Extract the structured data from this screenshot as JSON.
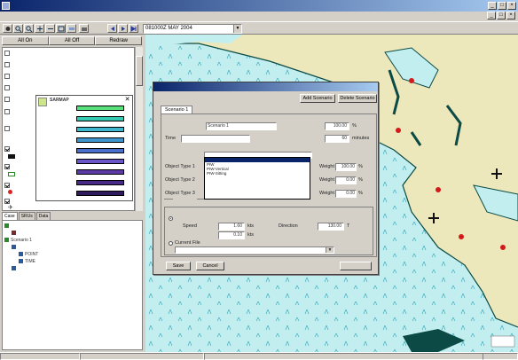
{
  "window": {
    "title": "",
    "controls": [
      "_",
      "□",
      "×"
    ]
  },
  "menu": [
    "",
    "",
    "",
    "",
    "",
    ""
  ],
  "toolbar": {
    "date_value": "081000Z MAY 2004"
  },
  "left_buttons": [
    "All On",
    "All Off",
    "Redraw"
  ],
  "layers": [
    {
      "label": "",
      "checked": false
    },
    {
      "label": "",
      "checked": false
    },
    {
      "label": "",
      "checked": false
    },
    {
      "label": "",
      "checked": false
    },
    {
      "label": "",
      "checked": false
    },
    {
      "label": "",
      "checked": false
    },
    {
      "label": "",
      "checked": false
    },
    {
      "label": "",
      "checked": true
    },
    {
      "label": "",
      "checked": true
    },
    {
      "label": "",
      "checked": true
    },
    {
      "label": "",
      "checked": true
    },
    {
      "label": "",
      "checked": true
    },
    {
      "label": "",
      "checked": true
    }
  ],
  "legend": {
    "title": "SARMAP",
    "rows": [
      {
        "label": "",
        "color": "#59e07a"
      },
      {
        "label": "",
        "color": "#34c9b0"
      },
      {
        "label": "",
        "color": "#3fb7cc"
      },
      {
        "label": "",
        "color": "#3f96cf"
      },
      {
        "label": "",
        "color": "#4a6ecc"
      },
      {
        "label": "",
        "color": "#6a56c8"
      },
      {
        "label": "",
        "color": "#5b3aa6"
      },
      {
        "label": "",
        "color": "#472a85"
      },
      {
        "label": "",
        "color": "#301a5e"
      }
    ]
  },
  "bottom_tabs": [
    "Case",
    "SRUs",
    "Data"
  ],
  "tree": [
    {
      "label": "",
      "color": "#2a8a2a"
    },
    {
      "label": "",
      "color": "#7a2a2a"
    },
    {
      "label": "Scenario 1",
      "color": "#2a8a2a"
    },
    {
      "label": "",
      "color": "#2a5a9a"
    },
    {
      "label": "POINT",
      "color": "#2a5a9a"
    },
    {
      "label": "TIME",
      "color": "#2a5a9a"
    },
    {
      "label": "",
      "color": "#2a5a9a"
    }
  ],
  "status": [
    "",
    "",
    ""
  ],
  "map_scale": "",
  "dialog": {
    "title": "",
    "add_scenario": "Add Scenario",
    "delete_scenario": "Delete Scenario",
    "tab": "Scenario 1",
    "settings_label": "",
    "name_label": "",
    "name_value": "Scenario 1",
    "weight_label": "",
    "weight_value": "100.00",
    "pct": "%",
    "time_label": "Time",
    "time_value": "",
    "plusminus_label": "",
    "plusminus_value": "60",
    "minutes": "minutes",
    "objects_label": "",
    "original_craft_label": "",
    "object_type_labels": [
      "Object Type 1",
      "Object Type 2",
      "Object Type 3"
    ],
    "object_weight_labels": [
      "Weight",
      "Weight",
      "Weight"
    ],
    "object_weights": [
      "100.00",
      "0.00",
      "0.00"
    ],
    "craft_dropdown": [
      "",
      "PIW",
      "PIW-Vertical",
      "PIW-Sitting",
      "",
      "",
      "",
      "",
      ""
    ],
    "sub_tabs": [
      "",
      "",
      ""
    ],
    "currents_label": "",
    "constant_current_label": "",
    "speed_label": "Speed",
    "speed_value": "1.60",
    "speed_unit": "kts",
    "direction_label": "Direction",
    "direction_value": "130.00",
    "direction_unit": "T",
    "speed_std_label": "",
    "speed_std_value": "0.10",
    "current_file_label": "Current File",
    "save_label": "Save",
    "cancel_label": "Cancel",
    "run_label": ""
  },
  "colors": {
    "land": "#ece8bb",
    "water": "#c2eef0",
    "shore": "#0b4a45",
    "accent": "#0a246a"
  }
}
